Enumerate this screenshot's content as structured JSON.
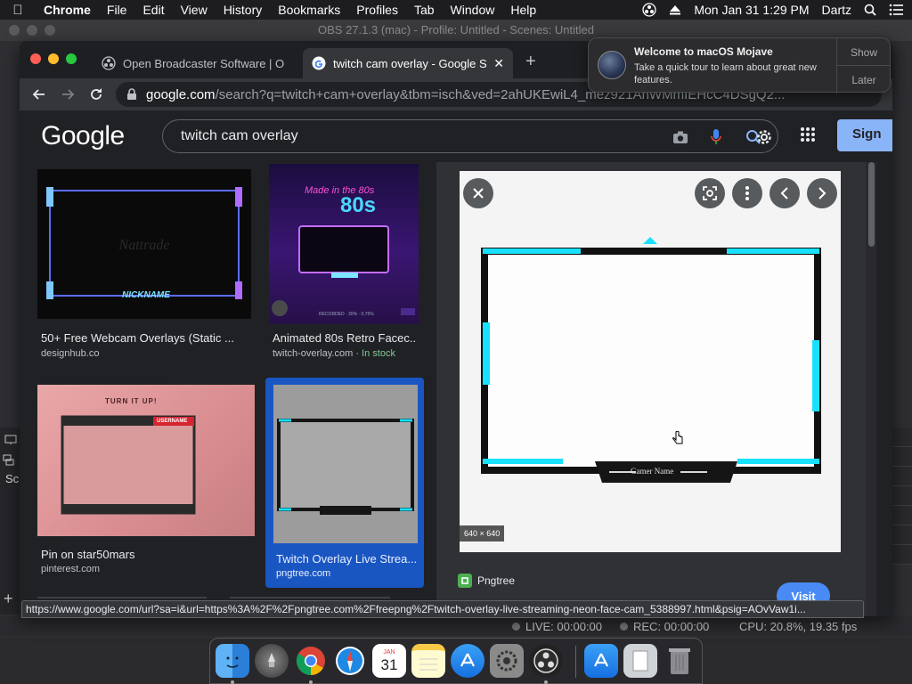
{
  "menubar": {
    "app_name": "Chrome",
    "items": [
      "File",
      "Edit",
      "View",
      "History",
      "Bookmarks",
      "Profiles",
      "Tab",
      "Window",
      "Help"
    ],
    "datetime": "Mon Jan 31  1:29 PM",
    "user": "Dartz"
  },
  "obs": {
    "title": "OBS 27.1.3 (mac) - Profile: Untitled - Scenes: Untitled",
    "scenes_label": "Sc",
    "live": "LIVE: 00:00:00",
    "rec": "REC: 00:00:00",
    "cpu": "CPU: 20.8%, 19.35 fps"
  },
  "chrome": {
    "tabs": [
      {
        "title": "Open Broadcaster Software | O",
        "favicon": "obs-icon"
      },
      {
        "title": "twitch cam overlay - Google Se",
        "favicon": "google-icon",
        "active": true
      }
    ],
    "url_host": "google.com",
    "url_path": "/search?q=twitch+cam+overlay&tbm=isch&ved=2ahUKEwiL4_mez921AhWMmIEHcC4DSgQ2..."
  },
  "search": {
    "logo": "Google",
    "query": "twitch cam overlay",
    "signin": "Sign"
  },
  "results": [
    {
      "title": "50+ Free Webcam Overlays (Static ...",
      "source": "designhub.co",
      "thumb_text": "NICKNAME"
    },
    {
      "title": "Animated 80s Retro Facec...",
      "source": "twitch-overlay.com",
      "badge": "In stock",
      "thumb_text": "Made in the 80s"
    },
    {
      "title": "Pin on star50mars",
      "source": "pinterest.com",
      "thumb_text": "TURN IT UP!",
      "thumb_sub": "USERNAME"
    },
    {
      "title": "Twitch Overlay Live Strea...",
      "source": "pngtree.com",
      "selected": true
    }
  ],
  "preview": {
    "dimensions": "640 × 640",
    "source": "Pngtree",
    "visit": "Visit",
    "banner_text": "Gamer Name"
  },
  "status_url": "https://www.google.com/url?sa=i&url=https%3A%2F%2Fpngtree.com%2Ffreepng%2Ftwitch-overlay-live-streaming-neon-face-cam_5388997.html&psig=AOvVaw1i...",
  "notification": {
    "title": "Welcome to macOS Mojave",
    "body": "Take a quick tour to learn about great new features.",
    "show": "Show",
    "later": "Later"
  },
  "dock": {
    "apps": [
      "finder-icon",
      "launchpad-icon",
      "chrome-icon",
      "safari-icon",
      "calendar-icon",
      "notes-icon",
      "app-store-icon",
      "system-preferences-icon",
      "obs-icon",
      "app-store-download-icon",
      "documents-icon",
      "trash-icon"
    ],
    "calendar_month": "JAN",
    "calendar_day": "31"
  },
  "colors": {
    "accent_blue": "#8ab4f8",
    "selected_card": "#1a56c2",
    "neon_cyan": "#18e1ff"
  }
}
